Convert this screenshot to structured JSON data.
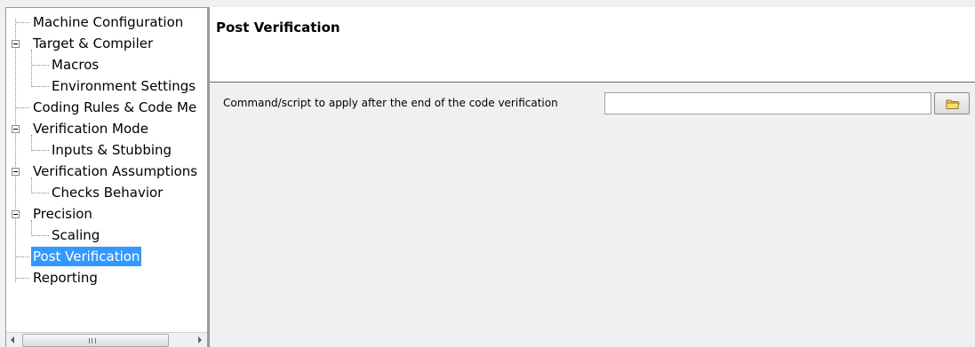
{
  "tree": {
    "items": [
      {
        "label": "Machine Configuration"
      },
      {
        "label": "Target & Compiler"
      },
      {
        "label": "Macros"
      },
      {
        "label": "Environment Settings"
      },
      {
        "label": "Coding Rules & Code Me"
      },
      {
        "label": "Verification Mode"
      },
      {
        "label": "Inputs & Stubbing"
      },
      {
        "label": "Verification Assumptions"
      },
      {
        "label": "Checks Behavior"
      },
      {
        "label": "Precision"
      },
      {
        "label": "Scaling"
      },
      {
        "label": "Post Verification"
      },
      {
        "label": "Reporting"
      }
    ],
    "selected": "Post Verification"
  },
  "content": {
    "title": "Post Verification",
    "command_label": "Command/script to apply after the end of the code verification",
    "command_value": "",
    "browse_icon": "folder-icon"
  },
  "colors": {
    "selection": "#3399ff",
    "folder": "#f2c94c"
  }
}
